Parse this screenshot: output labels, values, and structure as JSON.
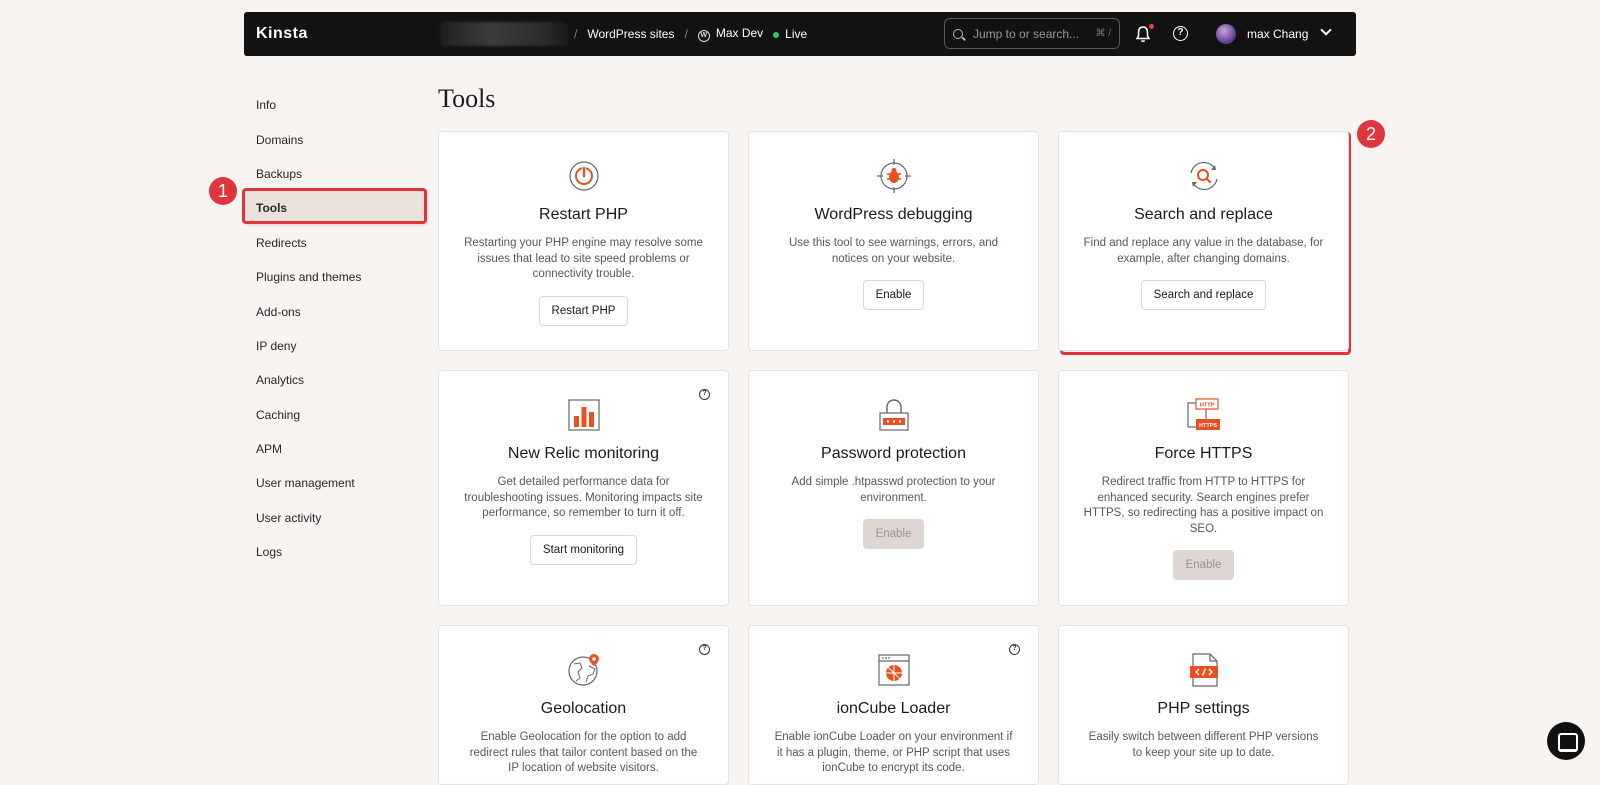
{
  "header": {
    "logo": "Kinsta",
    "breadcrumbs": {
      "sites": "WordPress sites",
      "site": "Max Dev",
      "env": "Live"
    },
    "search_placeholder": "Jump to or search...",
    "search_shortcut": "⌘ /",
    "user_name": "max Chang"
  },
  "sidebar": {
    "items": [
      "Info",
      "Domains",
      "Backups",
      "Tools",
      "Redirects",
      "Plugins and themes",
      "Add-ons",
      "IP deny",
      "Analytics",
      "Caching",
      "APM",
      "User management",
      "User activity",
      "Logs"
    ],
    "active": "Tools"
  },
  "annotations": {
    "one": "1",
    "two": "2"
  },
  "page_title": "Tools",
  "cards": [
    {
      "title": "Restart PHP",
      "desc": "Restarting your PHP engine may resolve some issues that lead to site speed problems or connectivity trouble.",
      "button": "Restart PHP",
      "icon": "power-icon"
    },
    {
      "title": "WordPress debugging",
      "desc": "Use this tool to see warnings, errors, and notices on your website.",
      "button": "Enable",
      "icon": "bug-icon"
    },
    {
      "title": "Search and replace",
      "desc": "Find and replace any value in the database, for example, after changing domains.",
      "button": "Search and replace",
      "icon": "search-replace-icon"
    },
    {
      "title": "New Relic monitoring",
      "desc": "Get detailed performance data for troubleshooting issues. Monitoring impacts site performance, so remember to turn it off.",
      "button": "Start monitoring",
      "icon": "bar-chart-icon"
    },
    {
      "title": "Password protection",
      "desc": "Add simple .htpasswd protection to your environment.",
      "button": "Enable",
      "icon": "lock-icon"
    },
    {
      "title": "Force HTTPS",
      "desc": "Redirect traffic from HTTP to HTTPS for enhanced security. Search engines prefer HTTPS, so redirecting has a positive impact on SEO.",
      "button": "Enable",
      "icon": "https-icon",
      "icon_text_top": "HTTP",
      "icon_text_bottom": "HTTPS"
    },
    {
      "title": "Geolocation",
      "desc": "Enable Geolocation for the option to add redirect rules that tailor content based on the IP location of website visitors.",
      "icon": "globe-icon"
    },
    {
      "title": "ionCube Loader",
      "desc": "Enable ionCube Loader on your environment if it has a plugin, theme, or PHP script that uses ionCube to encrypt its code.",
      "icon": "ioncube-icon"
    },
    {
      "title": "PHP settings",
      "desc": "Easily switch between different PHP versions to keep your site up to date.",
      "icon": "code-file-icon"
    }
  ],
  "colors": {
    "accent": "#e8511f",
    "marker": "#e0353d",
    "topbar": "#121212"
  }
}
